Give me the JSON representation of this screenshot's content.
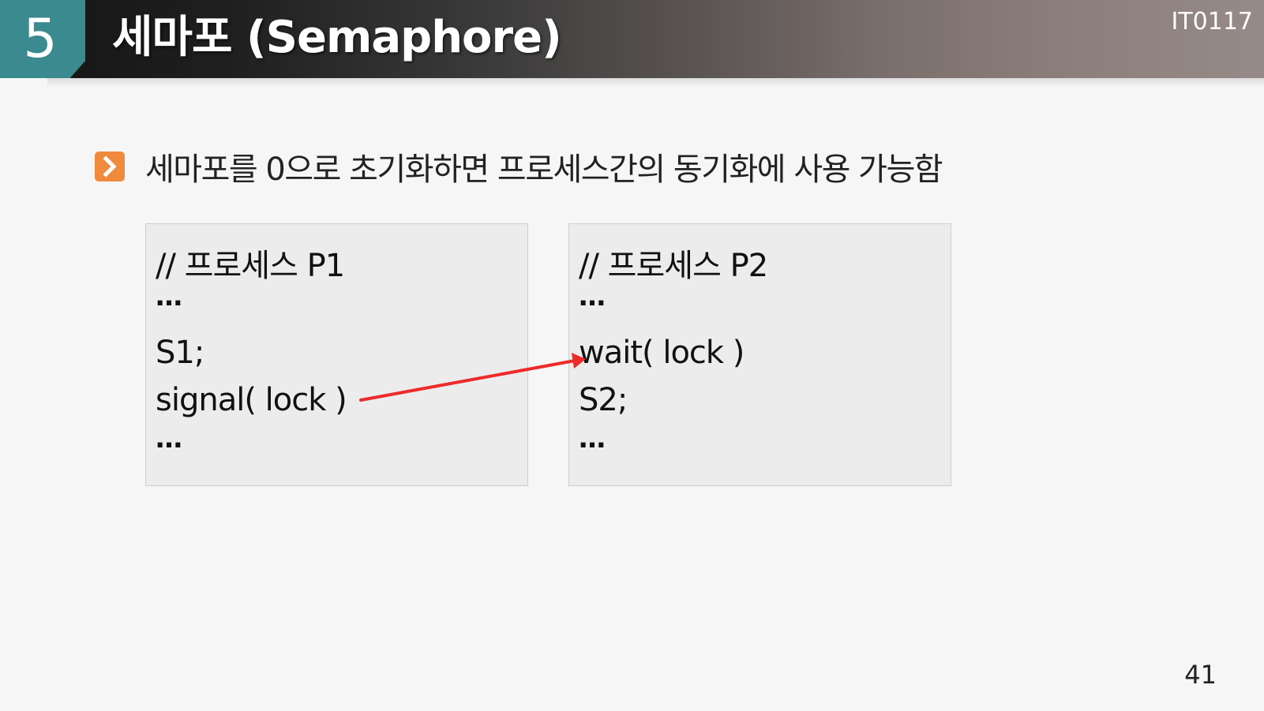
{
  "header": {
    "section_number": "5",
    "title": "세마포 (Semaphore)",
    "course_code": "IT0117"
  },
  "bullet": {
    "icon": "chevron-right-icon",
    "text": "세마포를 0으로 초기화하면 프로세스간의 동기화에 사용 가능함"
  },
  "process_p1": {
    "comment": "//   프로세스 P1",
    "lines": [
      "…",
      "S1;",
      "signal( lock )",
      "…"
    ]
  },
  "process_p2": {
    "comment": "//   프로세스 P2",
    "lines": [
      "…",
      "wait( lock )",
      "S2;",
      "…"
    ]
  },
  "arrow": {
    "color": "#ee2b2b"
  },
  "page_number": "41",
  "colors": {
    "section_badge": "#3a8a90",
    "bullet_icon": "#f08a3c",
    "background": "#f6f6f6"
  }
}
